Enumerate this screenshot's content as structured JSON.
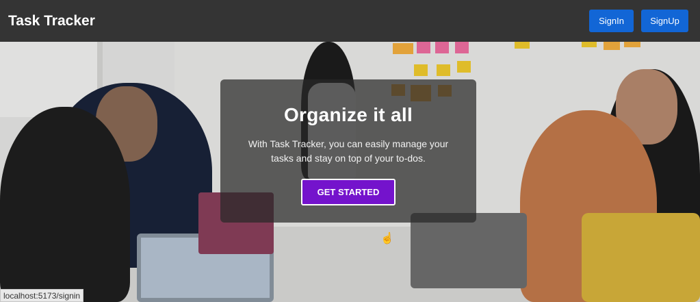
{
  "navbar": {
    "brand": "Task Tracker",
    "signin_label": "SignIn",
    "signup_label": "SignUp"
  },
  "hero": {
    "title": "Organize it all",
    "text": "With Task Tracker, you can easily manage your tasks and stay on top of your to-dos.",
    "cta_label": "GET STARTED"
  },
  "status_bar": {
    "url": "localhost:5173/signin"
  },
  "colors": {
    "navbar": "#343434",
    "nav_button": "#1266d6",
    "cta": "#7413cc"
  }
}
